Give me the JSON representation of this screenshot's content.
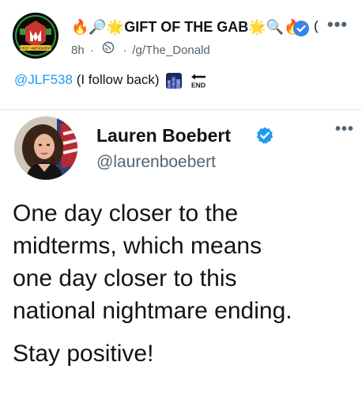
{
  "post": {
    "author_prefix_emoji": "🔥🔎🌟",
    "author_name": "GIFT OF THE GAB",
    "author_suffix_emoji": "🌟🔍🔥",
    "author_cut": "(",
    "time": "8h",
    "community": "/g/The_Donald",
    "avatar_text": "FIRST AMENDMENT",
    "more_label": "•••"
  },
  "comment": {
    "mention": "@JLF538",
    "text": "(I follow back)",
    "end_label": "END"
  },
  "tweet": {
    "name": "Lauren Boebert",
    "handle": "@laurenboebert",
    "more_label": "•••",
    "lines": [
      "One day closer to the",
      "midterms, which means",
      "one day closer to this",
      "national nightmare ending."
    ],
    "closing": "Stay positive!"
  },
  "colors": {
    "link": "#1d9bf0",
    "verified": "#1d9bf0",
    "muted": "#536471",
    "text": "#0f1419"
  }
}
